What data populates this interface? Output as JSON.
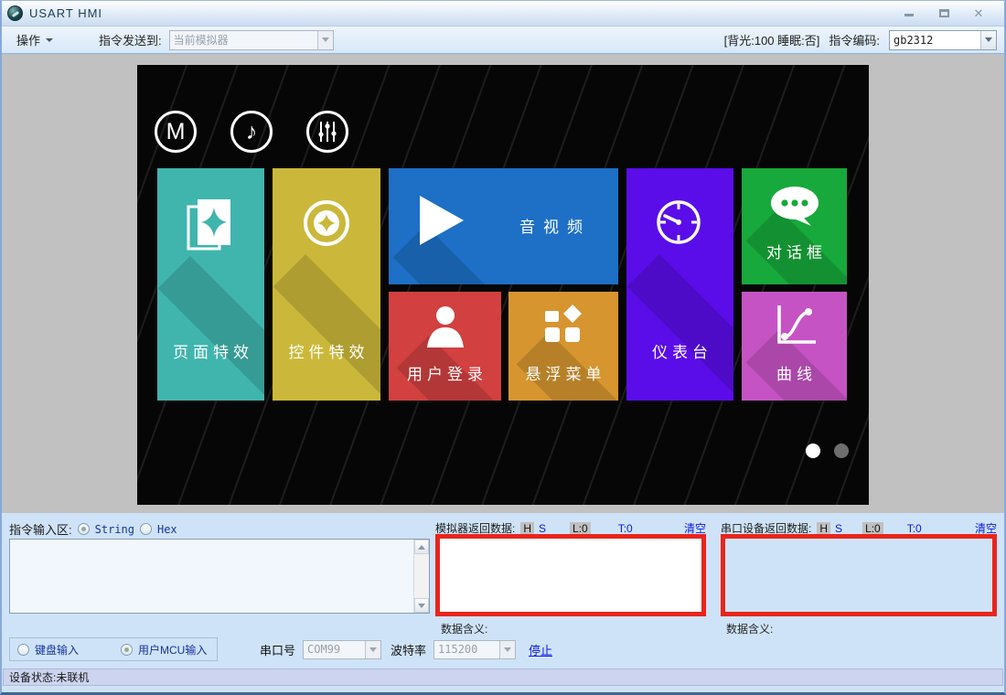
{
  "window": {
    "title": "USART HMI",
    "close_glyph": "✕"
  },
  "toolbar": {
    "menu": "操作",
    "send_to_label": "指令发送到:",
    "send_to_value": "当前模拟器",
    "status_text": "[背光:100  睡眠:否]",
    "encoding_label": "指令编码:",
    "encoding_value": "gb2312"
  },
  "screen": {
    "badge_m": "M",
    "badge_note": "♪",
    "tiles": [
      {
        "label": "页面特效",
        "color": "#3fb5ae"
      },
      {
        "label": "控件特效",
        "color": "#cbb83a"
      },
      {
        "label": "音视频",
        "color": "#1d70c6"
      },
      {
        "label": "用户登录",
        "color": "#d24040"
      },
      {
        "label": "悬浮菜单",
        "color": "#d6952f"
      },
      {
        "label": "仪表台",
        "color": "#5a0de8"
      },
      {
        "label": "对话框",
        "color": "#17a93b"
      },
      {
        "label": "曲线",
        "color": "#c653c4"
      }
    ],
    "pager": {
      "dots": 2,
      "active_index": 0
    }
  },
  "panels": {
    "command": {
      "label": "指令输入区:",
      "radio_string": "String",
      "radio_string_checked": true,
      "radio_hex": "Hex",
      "radio_hex_checked": false,
      "value": ""
    },
    "simulator": {
      "title": "模拟器返回数据:",
      "hex_toggle": "H",
      "string_toggle": "S",
      "length": "L:0",
      "count": "T:0",
      "clear": "清空",
      "meaning": "数据含义:",
      "value": ""
    },
    "device": {
      "title": "串口设备返回数据:",
      "hex_toggle": "H",
      "string_toggle": "S",
      "length": "L:0",
      "count": "T:0",
      "clear": "清空",
      "meaning": "数据含义:",
      "value": ""
    }
  },
  "controls": {
    "radio_keyboard": "键盘输入",
    "radio_keyboard_checked": false,
    "radio_mcu": "用户MCU输入",
    "radio_mcu_checked": true,
    "port_label": "串口号",
    "port_value": "COM99",
    "baud_label": "波特率",
    "baud_value": "115200",
    "stop": "停止"
  },
  "statusbar": {
    "text": "设备状态:未联机"
  }
}
